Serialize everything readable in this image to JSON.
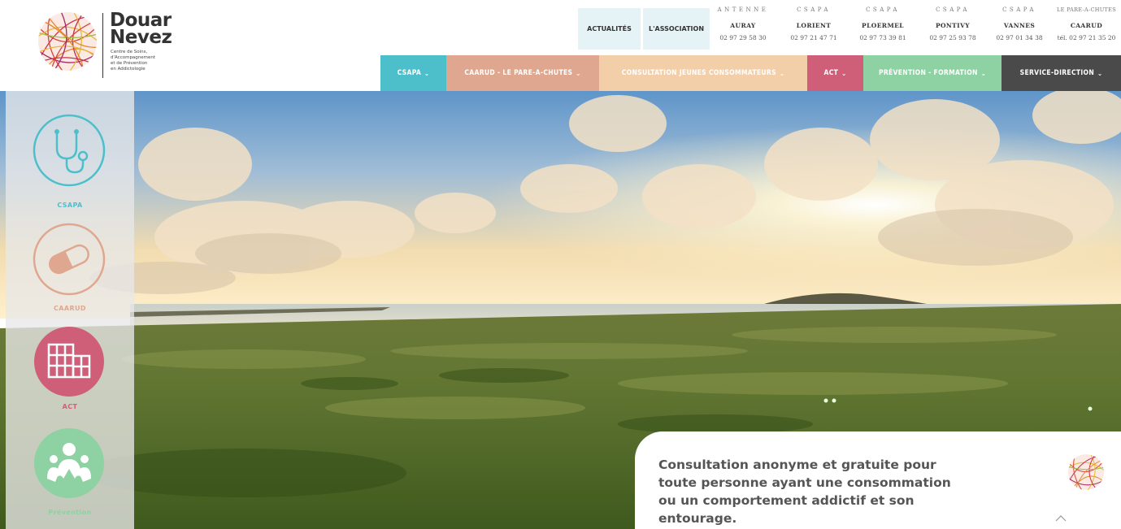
{
  "brand": {
    "name_line1": "Douar",
    "name_line2": "Nevez",
    "tagline_lines": [
      "Centre de Soins,",
      "d'Accompagnement",
      "et de Prévention",
      "en Addictologie"
    ]
  },
  "top_links": [
    {
      "label": "ACTUALITÉS"
    },
    {
      "label": "L'ASSOCIATION"
    }
  ],
  "antennas": [
    {
      "type": "ANTENNE",
      "city": "AURAY",
      "phone": "02 97 29 58 30"
    },
    {
      "type": "CSAPA",
      "city": "LORIENT",
      "phone": "02 97 21 47 71"
    },
    {
      "type": "CSAPA",
      "city": "PLOERMEL",
      "phone": "02 97 73 39 81"
    },
    {
      "type": "CSAPA",
      "city": "PONTIVY",
      "phone": "02 97 25 93 78"
    },
    {
      "type": "CSAPA",
      "city": "VANNES",
      "phone": "02 97 01 34 38"
    },
    {
      "type": "LE PARE-A-CHUTES",
      "city": "CAARUD",
      "phone": "tél. 02 97 21 35 20"
    }
  ],
  "main_nav": [
    {
      "label": "CSAPA",
      "color": "#4dbfcb"
    },
    {
      "label": "CAARUD - LE PARE-A-CHUTES",
      "color": "#dfa78f"
    },
    {
      "label": "CONSULTATION JEUNES CONSOMMATEURS",
      "color": "#f3cfa9"
    },
    {
      "label": "ACT",
      "color": "#cf5f78"
    },
    {
      "label": "PRÉVENTION - FORMATION",
      "color": "#8ed1a2"
    },
    {
      "label": "SERVICE-DIRECTION",
      "color": "#4a4a4a"
    }
  ],
  "nav_chevron": "⌄",
  "sidebar": [
    {
      "label": "CSAPA",
      "icon": "stethoscope-icon",
      "color": "#4dbfcb"
    },
    {
      "label": "CAARUD",
      "icon": "pill-icon",
      "color": "#dfa78f"
    },
    {
      "label": "ACT",
      "icon": "buildings-icon",
      "color": "#cf5f78"
    },
    {
      "label": "Prévention",
      "icon": "people-icon",
      "color": "#8ed1a2"
    }
  ],
  "info_card": {
    "text": "Consultation anonyme et gratuite pour toute personne ayant une consommation ou un comportement addictif et son entourage."
  }
}
